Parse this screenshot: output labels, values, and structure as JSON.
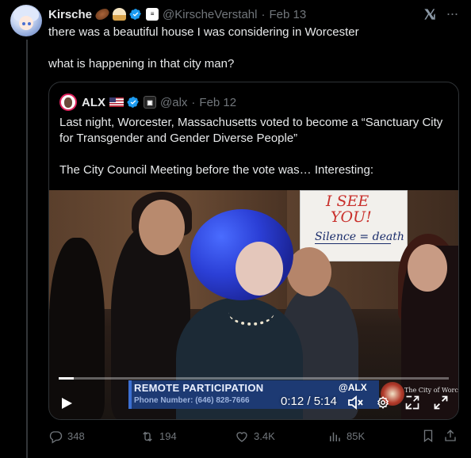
{
  "author": {
    "name": "Kirsche",
    "handle": "@KirscheVerstahl",
    "date": "Feb 13"
  },
  "post": {
    "line1": "there was a beautiful house I was considering in Worcester",
    "line2": "what is happening in that city man?"
  },
  "quoted": {
    "name": "ALX",
    "handle": "@alx",
    "date": "Feb 12",
    "para1": "Last night, Worcester, Massachusetts voted to become a “Sanctuary City for Transgender and Gender Diverse People”",
    "para2": "The City Council Meeting before the vote was… Interesting:",
    "video": {
      "sign_line1": "I SEE",
      "sign_line2": "YOU!",
      "sign_line3": "Silence = death",
      "banner_title": "REMOTE PARTICIPATION",
      "banner_phone": "Phone Number: (646) 828-7666",
      "banner_brand": "@ALX",
      "city_seal_text": "The City of Worcester",
      "time": "0:12 / 5:14",
      "progress": 0.038
    }
  },
  "metrics": {
    "replies": "348",
    "reposts": "194",
    "likes": "3.4K",
    "views": "85K"
  },
  "colors": {
    "background": "#000000",
    "text": "#e7e9ea",
    "muted": "#71767b",
    "verified": "#1d9bf0",
    "border": "#2f3336"
  },
  "icons": [
    "verified-badge-icon",
    "grok-icon",
    "more-icon",
    "play-icon",
    "volume-icon",
    "gear-icon",
    "pip-icon",
    "fullscreen-icon",
    "reply-icon",
    "repost-icon",
    "like-icon",
    "views-icon",
    "bookmark-icon",
    "share-icon"
  ]
}
